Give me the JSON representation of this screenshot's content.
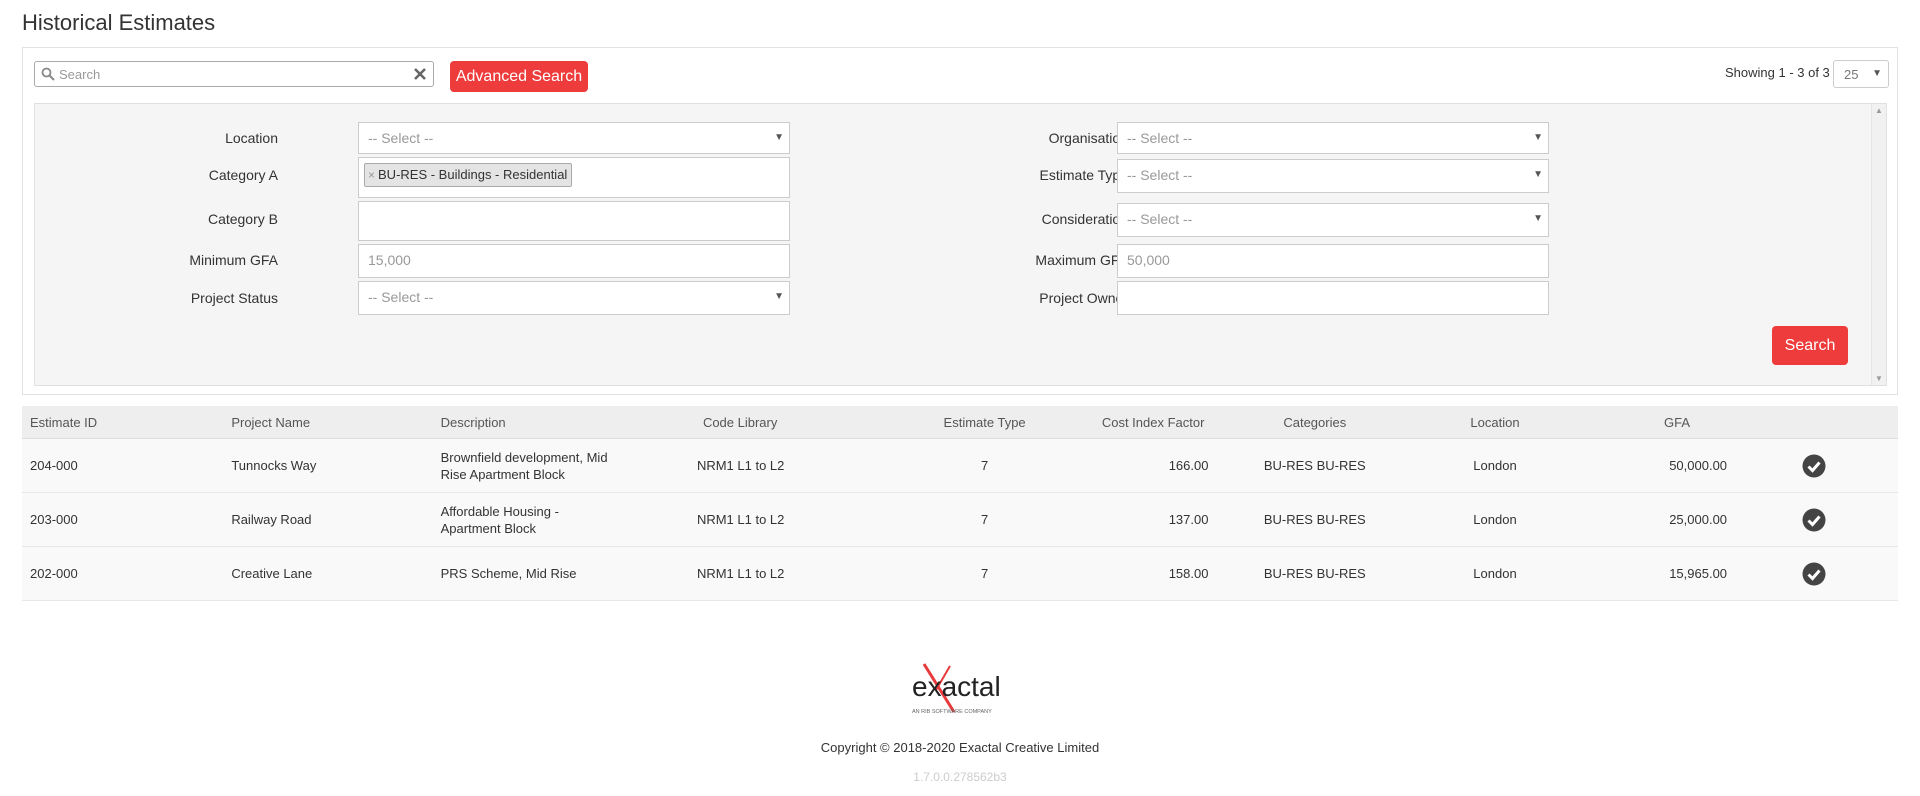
{
  "page": {
    "title": "Historical Estimates"
  },
  "toolbar": {
    "search_placeholder": "Search",
    "advanced_search_label": "Advanced Search",
    "showing_text": "Showing 1 - 3 of 3",
    "page_size": "25"
  },
  "filters": {
    "location": {
      "label": "Location",
      "value": "-- Select --"
    },
    "category_a": {
      "label": "Category A",
      "tag": "BU-RES - Buildings - Residential",
      "tag_remove": "×"
    },
    "category_b": {
      "label": "Category B",
      "value": ""
    },
    "minimum_gfa": {
      "label": "Minimum GFA",
      "placeholder": "15,000"
    },
    "project_status": {
      "label": "Project Status",
      "value": "-- Select --"
    },
    "organisation": {
      "label": "Organisation",
      "value": "-- Select --"
    },
    "estimate_type": {
      "label": "Estimate Type",
      "value": "-- Select --"
    },
    "consideration": {
      "label": "Consideration",
      "value": "-- Select --"
    },
    "maximum_gfa": {
      "label": "Maximum GFA",
      "placeholder": "50,000"
    },
    "project_owner": {
      "label": "Project Owner",
      "value": ""
    },
    "search_button": "Search"
  },
  "table": {
    "columns": [
      "Estimate ID",
      "Project Name",
      "Description",
      "Code Library",
      "Estimate Type",
      "Cost Index Factor",
      "Categories",
      "Location",
      "GFA"
    ],
    "rows": [
      {
        "id": "204-000",
        "project": "Tunnocks Way",
        "description": "Brownfield development, Mid Rise Apartment Block",
        "code_library": "NRM1 L1 to L2",
        "estimate_type": "7",
        "cost_index": "166.00",
        "categories": "BU-RES BU-RES",
        "location": "London",
        "gfa": "50,000.00"
      },
      {
        "id": "203-000",
        "project": "Railway Road",
        "description": "Affordable Housing - Apartment Block",
        "code_library": "NRM1 L1 to L2",
        "estimate_type": "7",
        "cost_index": "137.00",
        "categories": "BU-RES BU-RES",
        "location": "London",
        "gfa": "25,000.00"
      },
      {
        "id": "202-000",
        "project": "Creative Lane",
        "description": "PRS Scheme, Mid Rise",
        "code_library": "NRM1 L1 to L2",
        "estimate_type": "7",
        "cost_index": "158.00",
        "categories": "BU-RES BU-RES",
        "location": "London",
        "gfa": "15,965.00"
      }
    ]
  },
  "footer": {
    "logo_text": "exactal",
    "logo_tagline": "AN RIB SOFTWARE COMPANY",
    "copyright": "Copyright © 2018-2020 Exactal Creative Limited",
    "version": "1.7.0.0.278562b3"
  },
  "colors": {
    "accent": "#ee3b3b",
    "header_bg": "#eeeeee",
    "panel_bg": "#f5f5f5"
  },
  "icons": {
    "search": "search-icon",
    "clear": "clear-icon",
    "select": "check-circle-icon"
  }
}
